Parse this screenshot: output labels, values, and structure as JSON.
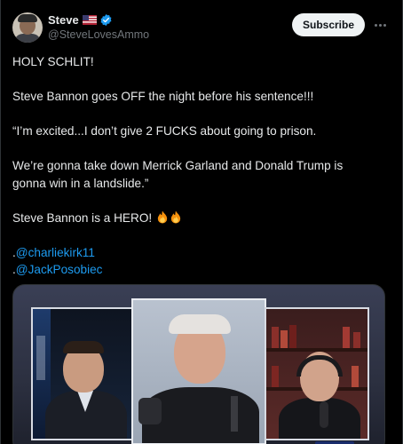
{
  "author": {
    "display_name": "Steve",
    "handle": "@SteveLovesAmmo"
  },
  "actions": {
    "subscribe_label": "Subscribe"
  },
  "tweet": {
    "line1": "HOLY SCHLIT!",
    "line2": "Steve Bannon goes OFF the night before his sentence!!!",
    "line3": "“I’m excited...I don’t give 2 FUCKS about going to prison.",
    "line4a": "We’re gonna take down Merrick Garland and Donald Trump is",
    "line4b": "gonna win in a landslide.”",
    "line5": "Steve Bannon is a HERO!",
    "mention1_prefix": ".",
    "mention1": "@charliekirk11",
    "mention2_prefix": ".",
    "mention2": "@JackPosobiec"
  },
  "icons": {
    "flag": "us-flag-icon",
    "verified": "verified-badge-icon",
    "fire": "fire-emoji-icon",
    "more": "more-options-icon"
  },
  "colors": {
    "background": "#000000",
    "text": "#e7e9ea",
    "secondary_text": "#71767b",
    "link": "#1d9bf0",
    "verified": "#1d9bf0",
    "subscribe_bg": "#eff3f4"
  }
}
